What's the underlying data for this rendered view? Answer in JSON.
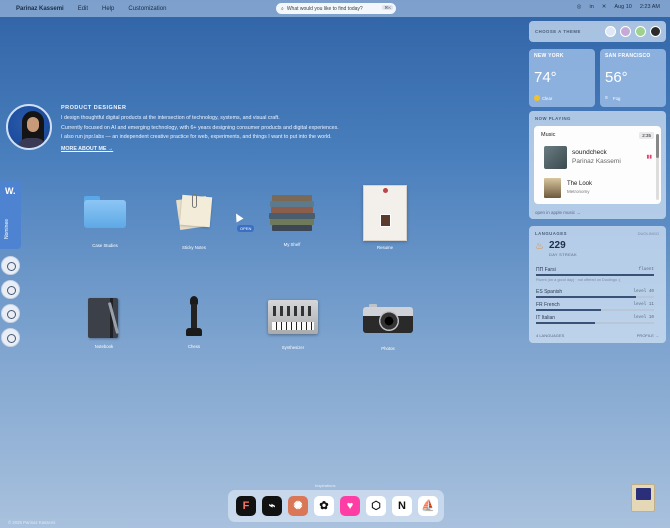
{
  "menubar": {
    "apple_glyph": "",
    "name": "Parinaz Kassemi",
    "menus": [
      "Edit",
      "Help",
      "Customization"
    ],
    "search_placeholder": "What would you like to find today?",
    "search_shortcut": "⌘K",
    "date": "Aug 10",
    "time": "2:23 AM"
  },
  "profile": {
    "role": "PRODUCT DESIGNER",
    "line1": "I design thoughtful digital products at the intersection of technology, systems, and visual craft.",
    "line2": "Currently focused on AI and emerging technology, with 6+ years designing consumer products and digital experiences.",
    "line3": "I also run jnpr.labs — an independent creative practice for web, experiments, and things I want to put into the world.",
    "more_link": "MORE ABOUT ME →"
  },
  "nominee": {
    "badge": "W.",
    "label": "Nominee"
  },
  "desktop_icons": [
    {
      "label": "Case Studies",
      "icon": "folder-icon"
    },
    {
      "label": "Sticky Notes",
      "icon": "sticky-notes-icon"
    },
    {
      "label": "My Shelf",
      "icon": "books-icon"
    },
    {
      "label": "Resume",
      "icon": "resume-icon"
    },
    {
      "label": "Notebook",
      "icon": "notebook-icon"
    },
    {
      "label": "Chess",
      "icon": "chess-icon"
    },
    {
      "label": "Synthesizer",
      "icon": "synthesizer-icon"
    },
    {
      "label": "Photos",
      "icon": "camera-icon"
    }
  ],
  "cursor_tip": "OPEN",
  "theme": {
    "title": "CHOOSE A THEME",
    "colors": [
      "#dfe8f6",
      "#c5a9d6",
      "#9ed08f",
      "#2b2b2b"
    ]
  },
  "weather": [
    {
      "city": "NEW YORK",
      "temp": "74°",
      "condition": "Clear"
    },
    {
      "city": "SAN FRANCISCO",
      "temp": "56°",
      "condition": "Fog"
    }
  ],
  "now_playing": {
    "title": "NOW PLAYING",
    "app": "Music",
    "time": "2:35",
    "track1": "soundcheck",
    "artist1": "Parinaz Kassemi",
    "track2": "The Look",
    "artist2": "Metronomy",
    "footer_link": "open in apple music →"
  },
  "languages": {
    "title": "LANGUAGES",
    "subtitle": "DUOLINGO",
    "streak": "229",
    "streak_label": "DAY STREAK",
    "items": [
      {
        "name": "Farsi",
        "level": "fluent",
        "note": "Fluent (on a good day) · not offered on Duolingo :(",
        "progress": 1.0
      },
      {
        "name": "Spanish",
        "level": "level 40",
        "progress": 0.85
      },
      {
        "name": "French",
        "level": "level 11",
        "progress": 0.55
      },
      {
        "name": "Italian",
        "level": "level 10",
        "progress": 0.5
      }
    ],
    "count_label": "4 LANGUAGES",
    "profile_link": "PROFILE →"
  },
  "dock": {
    "label": "Inspirations",
    "apps": [
      {
        "name": "figma-icon",
        "glyph": "F",
        "bg": "#111111",
        "fg": "#ff7262"
      },
      {
        "name": "framer-icon",
        "glyph": "⌁",
        "bg": "#111111",
        "fg": "#ffffff"
      },
      {
        "name": "claude-icon",
        "glyph": "✺",
        "bg": "#d97757",
        "fg": "#ffffff"
      },
      {
        "name": "openai-icon",
        "glyph": "✿",
        "bg": "#ffffff",
        "fg": "#111111"
      },
      {
        "name": "heart-app-icon",
        "glyph": "♥",
        "bg": "#ff3ea5",
        "fg": "#ffffff"
      },
      {
        "name": "box-3d-icon",
        "glyph": "⬡",
        "bg": "#ffffff",
        "fg": "#111111"
      },
      {
        "name": "notion-icon",
        "glyph": "N",
        "bg": "#ffffff",
        "fg": "#111111"
      },
      {
        "name": "sailboat-icon",
        "glyph": "⛵",
        "bg": "#ffffff",
        "fg": "#111111"
      }
    ]
  },
  "footer": "© 2025 Parinaz Kassemi"
}
